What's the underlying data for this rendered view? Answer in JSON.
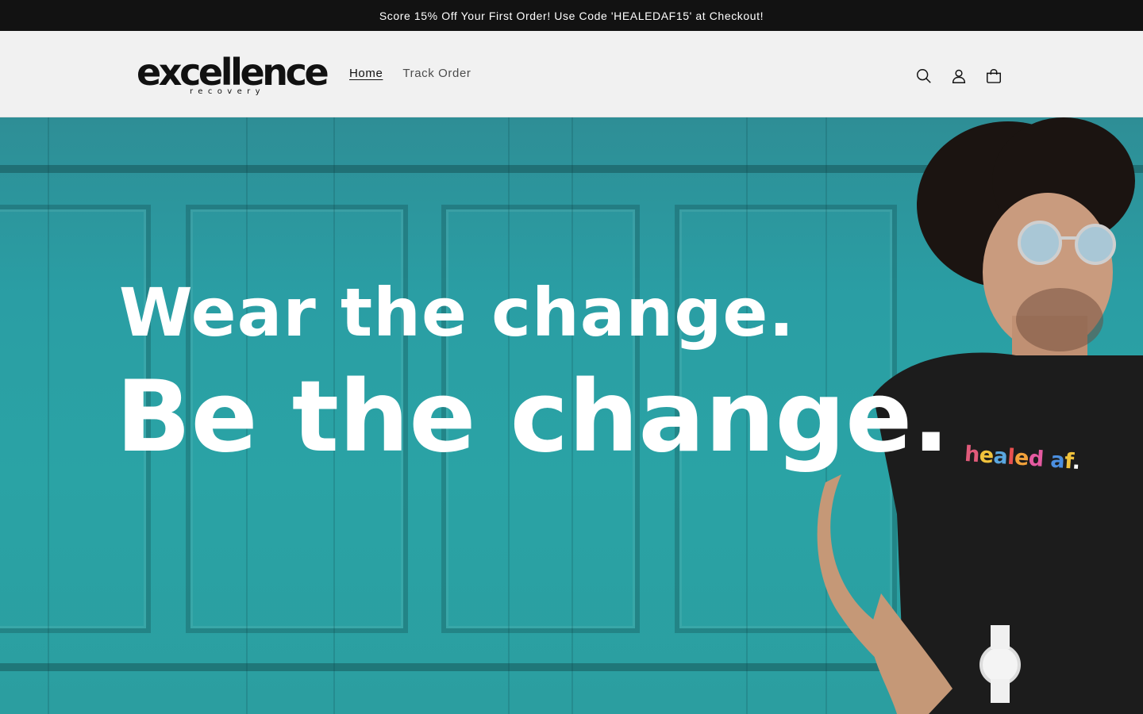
{
  "announcement": {
    "text": "Score 15% Off Your First Order! Use Code 'HEALEDAF15' at Checkout!"
  },
  "header": {
    "logo": {
      "word": "excellence",
      "sub": "recovery"
    },
    "nav": [
      {
        "label": "Home",
        "active": true
      },
      {
        "label": "Track Order",
        "active": false
      }
    ],
    "icons": [
      "search-icon",
      "account-icon",
      "cart-icon"
    ]
  },
  "hero": {
    "line1": "Wear the change.",
    "line2": "Be the change.",
    "shirt_text": [
      "h",
      "e",
      "a",
      "l",
      "e",
      "d",
      " ",
      "a",
      "f",
      "."
    ],
    "shirt_colors": [
      "#e05a7a",
      "#f0c23c",
      "#5aa7e0",
      "#e85050",
      "#f2a13a",
      "#e55aa0",
      "#ffffff",
      "#4b8fe0",
      "#f0c23c",
      "#ffffff"
    ]
  },
  "colors": {
    "announcement_bg": "#121212",
    "header_bg": "#f1f1f1",
    "hero_teal": "#2aa3a5"
  }
}
